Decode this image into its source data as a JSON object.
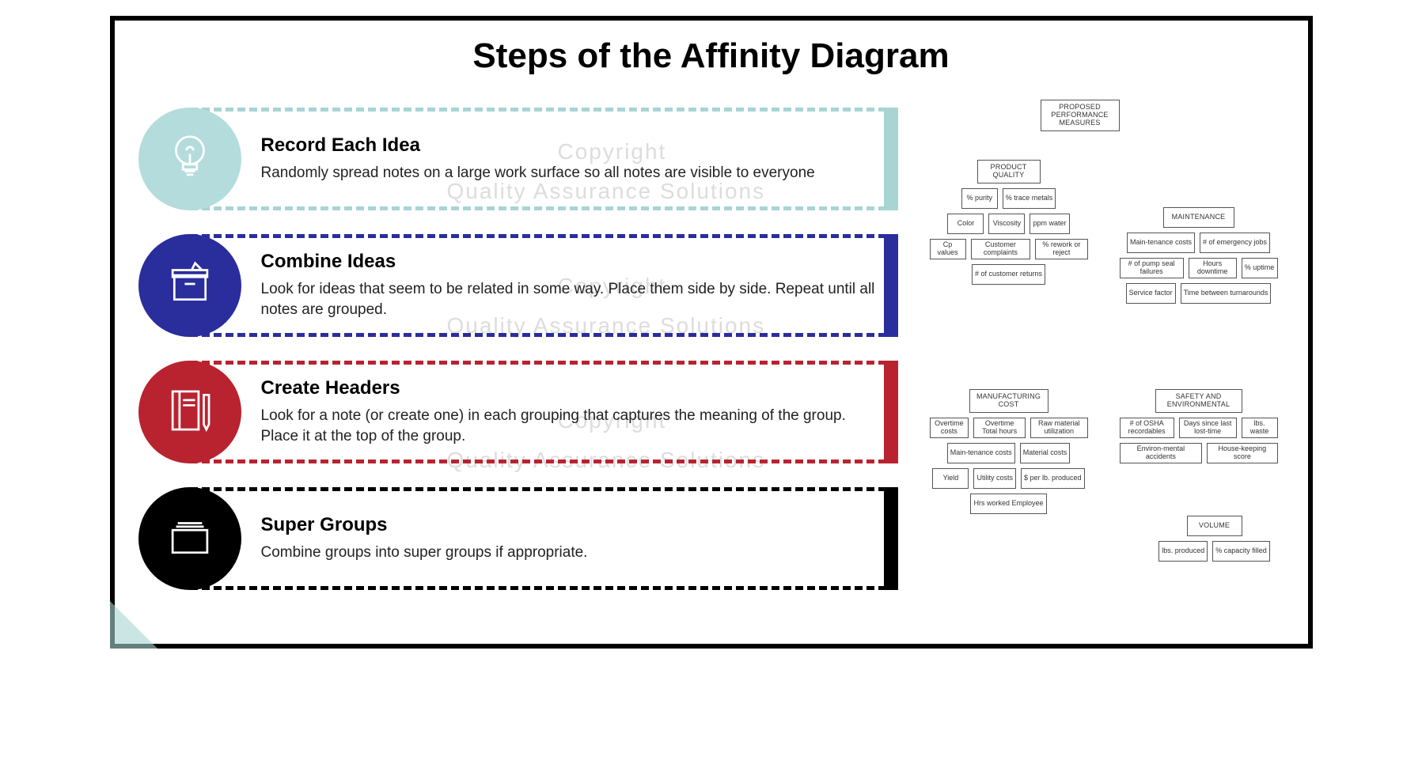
{
  "title": "Steps of the Affinity Diagram",
  "steps": [
    {
      "icon": "lightbulb",
      "title": "Record Each Idea",
      "desc": "Randomly spread notes on a large work surface so all notes are visible to everyone"
    },
    {
      "icon": "box",
      "title": "Combine Ideas",
      "desc": "Look for ideas that seem to be related in some way. Place them side by side. Repeat until all notes are grouped."
    },
    {
      "icon": "notebook",
      "title": "Create Headers",
      "desc": "Look for a note (or create one) in each grouping that captures the meaning of the group. Place it at the top of the group."
    },
    {
      "icon": "folder",
      "title": "Super Groups",
      "desc": "Combine groups into super groups if appropriate."
    }
  ],
  "example": {
    "root": "PROPOSED PERFORMANCE MEASURES",
    "groups": [
      {
        "header": "PRODUCT QUALITY",
        "items": [
          "% purity",
          "% trace metals",
          "Color",
          "Viscosity",
          "ppm water",
          "Cp values",
          "Customer complaints",
          "% rework or reject",
          "# of customer returns"
        ]
      },
      {
        "header": "MAINTENANCE",
        "items": [
          "Main-tenance costs",
          "# of emergency jobs",
          "# of pump seal failures",
          "Hours downtime",
          "% uptime",
          "Service factor",
          "Time between turnarounds"
        ]
      },
      {
        "header": "MANUFACTURING COST",
        "items": [
          "Overtime costs",
          "Overtime Total hours",
          "Raw material utilization",
          "Main-tenance costs",
          "Material costs",
          "Yield",
          "Utility costs",
          "$ per lb. produced",
          "Hrs worked Employee"
        ]
      },
      {
        "header": "SAFETY AND ENVIRONMENTAL",
        "items": [
          "# of OSHA recordables",
          "Days since last lost-time",
          "lbs. waste",
          "Environ-mental accidents",
          "House-keeping score"
        ]
      },
      {
        "header": "VOLUME",
        "items": [
          "lbs. produced",
          "% capacity filled"
        ]
      }
    ]
  },
  "watermark": {
    "line1": "Copyright",
    "line2": "Quality Assurance Solutions"
  }
}
